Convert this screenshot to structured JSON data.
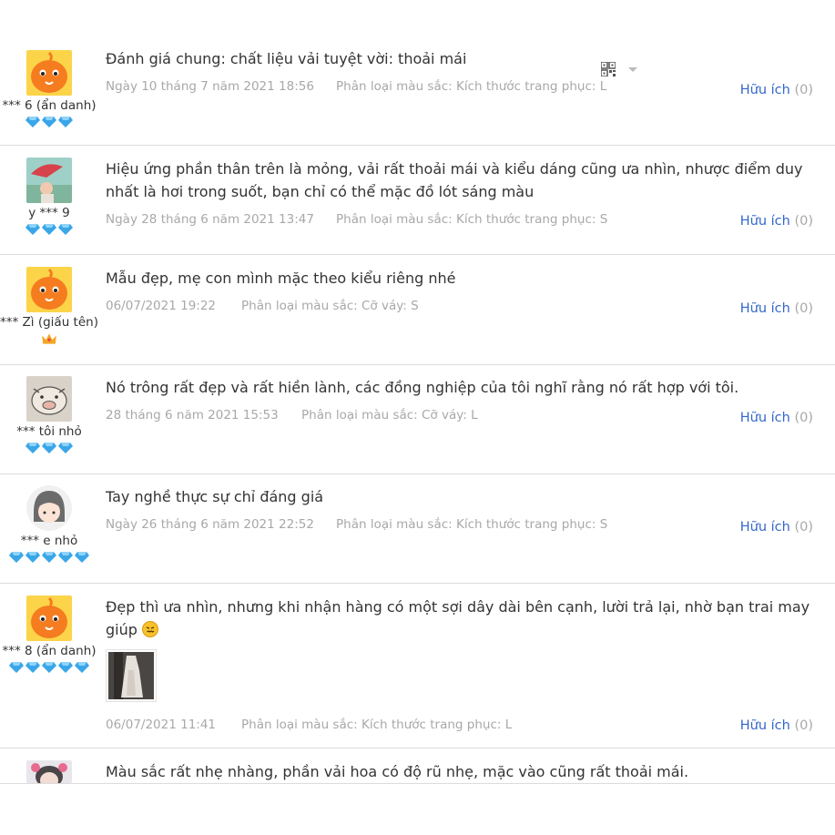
{
  "reviews": [
    {
      "user": "*** 6 (ẩn danh)",
      "avatar": "orange-mascot",
      "badge": "diamond",
      "badge_count": 3,
      "text": "Đánh giá chung: chất liệu vải tuyệt vời: thoải mái",
      "date": "Ngày 10 tháng 7 năm 2021 18:56",
      "category": "Phân loại màu sắc: Kích thước trang phục: L",
      "helpful_label": "Hữu ích",
      "helpful_count": "(0)"
    },
    {
      "user": "y *** 9",
      "avatar": "photo-umbrella",
      "badge": "diamond",
      "badge_count": 3,
      "text": "Hiệu ứng phần thân trên là mỏng, vải rất thoải mái và kiểu dáng cũng ưa nhìn, nhược điểm duy nhất là hơi trong suốt, bạn chỉ có thể mặc đồ lót sáng màu",
      "date": "Ngày 28 tháng 6 năm 2021 13:47",
      "category": "Phân loại màu sắc: Kích thước trang phục: S",
      "helpful_label": "Hữu ích",
      "helpful_count": "(0)"
    },
    {
      "user": "*** Zì (giấu tên)",
      "avatar": "orange-mascot",
      "badge": "crown",
      "badge_count": 1,
      "text": "Mẫu đẹp, mẹ con mình mặc theo kiểu riêng nhé",
      "date": "06/07/2021 19:22",
      "category": "Phân loại màu sắc: Cỡ váy: S",
      "helpful_label": "Hữu ích",
      "helpful_count": "(0)"
    },
    {
      "user": "*** tôi nhỏ",
      "avatar": "drawn-pig",
      "badge": "diamond",
      "badge_count": 3,
      "text": "Nó trông rất đẹp và rất hiền lành, các đồng nghiệp của tôi nghĩ rằng nó rất hợp với tôi.",
      "date": "28 tháng 6 năm 2021 15:53",
      "category": "Phân loại màu sắc: Cỡ váy: L",
      "helpful_label": "Hữu ích",
      "helpful_count": "(0)"
    },
    {
      "user": "*** e nhỏ",
      "avatar": "cartoon-girl",
      "badge": "diamond",
      "badge_count": 5,
      "text": "Tay nghề thực sự chỉ đáng giá",
      "date": "Ngày 26 tháng 6 năm 2021 22:52",
      "category": "Phân loại màu sắc: Kích thước trang phục: S",
      "helpful_label": "Hữu ích",
      "helpful_count": "(0)"
    },
    {
      "user": "*** 8 (ẩn danh)",
      "avatar": "orange-mascot",
      "badge": "diamond",
      "badge_count": 5,
      "text": "Đẹp thì ưa nhìn, nhưng khi nhận hàng có một sợi dây dài bên cạnh, lười trả lại, nhờ bạn trai may giúp",
      "emoji": "annoyed-face-emoji",
      "photo": "dress-photo-thumbnail",
      "date": "06/07/2021 11:41",
      "category": "Phân loại màu sắc: Kích thước trang phục: L",
      "helpful_label": "Hữu ích",
      "helpful_count": "(0)"
    },
    {
      "user": "",
      "avatar": "photo-girl",
      "text": "Màu sắc rất nhẹ nhàng, phần vải hoa có độ rũ nhẹ, mặc vào cũng rất thoải mái."
    }
  ],
  "icons": {
    "qr": "qr-code-icon",
    "dropdown": "chevron-down-icon"
  },
  "colors": {
    "link": "#3366cc",
    "meta": "#a8a8a8",
    "divider": "#dcdcdc",
    "diamond": "#3aa6e8",
    "mascot": "#f57c1f"
  }
}
